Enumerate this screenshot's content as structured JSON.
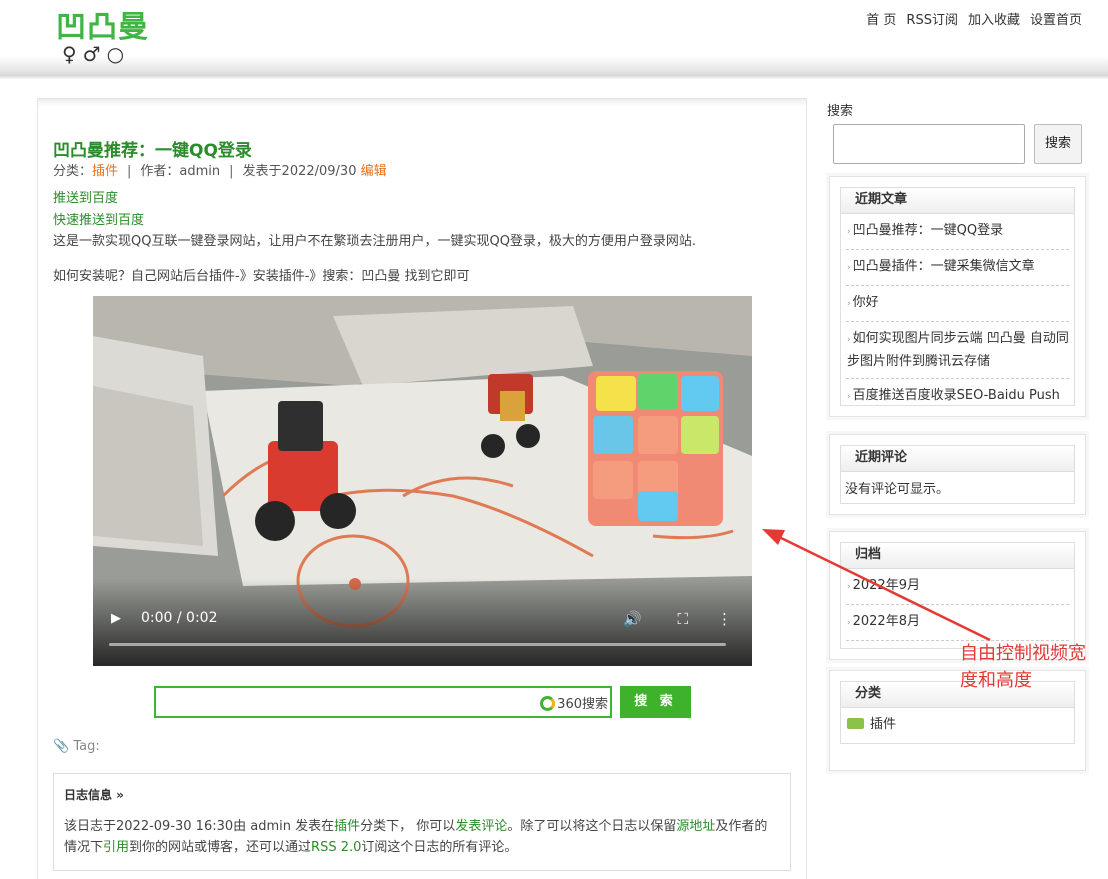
{
  "site": {
    "logo_text": "凹凸曼",
    "logo_gender": "♀♂○",
    "nav": [
      "首 页",
      "RSS订阅",
      "加入收藏",
      "设置首页"
    ]
  },
  "post": {
    "title": "凹凸曼推荐：一键QQ登录",
    "meta_category_label": "分类：",
    "meta_category": "插件",
    "meta_author": "作者：admin",
    "meta_date": "发表于2022/09/30",
    "meta_edit": "编辑",
    "link1": "推送到百度",
    "link2": "快速推送到百度",
    "para1": "这是一款实现QQ互联一键登录网站，让用户不在繁琐去注册用户，一键实现QQ登录，极大的方便用户登录网站.",
    "para2": "如何安装呢？自己网站后台插件-》安装插件-》搜索：凹凸曼 找到它即可",
    "video_time": "0:00 / 0:02",
    "search_brand": "360搜索",
    "search_button": "搜 索",
    "tag_label": "Tag:",
    "info_title": "日志信息 »",
    "info_p1": "该日志于2022-09-30 16:30由 admin 发表在",
    "info_cat": "插件",
    "info_p2": "分类下， 你可以",
    "info_comment": "发表评论",
    "info_p3": "。除了可以将这个日志以保留",
    "info_src": "源地址",
    "info_p4": "及作者的情况下",
    "info_quote": "引用",
    "info_p5": "到你的网站或博客，还可以通过",
    "info_rss": "RSS 2.0",
    "info_p6": "订阅这个日志的所有评论。"
  },
  "sidebar": {
    "search_label": "搜索",
    "search_button": "搜索",
    "recent_title": "近期文章",
    "recent": [
      "凹凸曼推荐：一键QQ登录",
      "凹凸曼插件：一键采集微信文章",
      "你好",
      "如何实现图片同步云端 凹凸曼 自动同步图片附件到腾讯云存储",
      "百度推送百度收录SEO-Baidu Push"
    ],
    "comments_title": "近期评论",
    "comments_text": "没有评论可显示。",
    "archive_title": "归档",
    "archive": [
      "2022年9月",
      "2022年8月"
    ],
    "category_title": "分类",
    "category": [
      "插件"
    ]
  },
  "annotation": {
    "line1": "自由控制视频宽",
    "line2": "度和高度"
  },
  "colors": {
    "brand_green": "#3fb644",
    "link_green": "#2a8c2a",
    "highlight_orange": "#e8731f",
    "annotation_red": "#e53935"
  }
}
